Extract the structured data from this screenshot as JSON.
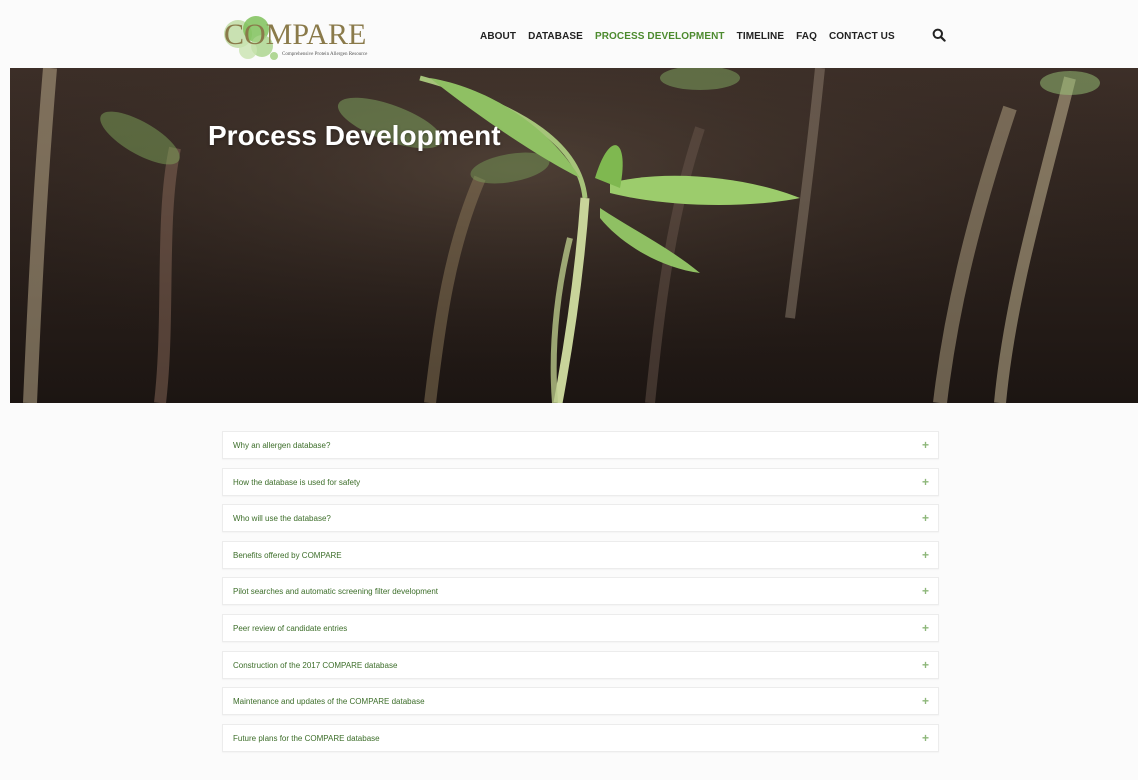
{
  "brand": {
    "name": "COMPARE",
    "tagline": "Comprehensive Protein Allergen Resource"
  },
  "nav": {
    "items": [
      {
        "label": "ABOUT",
        "active": false
      },
      {
        "label": "DATABASE",
        "active": false
      },
      {
        "label": "PROCESS DEVELOPMENT",
        "active": true
      },
      {
        "label": "TIMELINE",
        "active": false
      },
      {
        "label": "FAQ",
        "active": false
      },
      {
        "label": "CONTACT US",
        "active": false
      }
    ],
    "search_icon": "search-icon"
  },
  "hero": {
    "title": "Process Development"
  },
  "accordion": {
    "expand_icon": "plus-icon",
    "expand_glyph": "+",
    "items": [
      {
        "label": "Why an allergen database?"
      },
      {
        "label": "How the database is used for safety"
      },
      {
        "label": "Who will use the database?"
      },
      {
        "label": "Benefits offered by COMPARE"
      },
      {
        "label": "Pilot searches and automatic screening filter development"
      },
      {
        "label": "Peer review of candidate entries"
      },
      {
        "label": "Construction of the 2017 COMPARE database"
      },
      {
        "label": "Maintenance and updates of the COMPARE database"
      },
      {
        "label": "Future plans for the COMPARE database"
      }
    ]
  },
  "colors": {
    "accent": "#4c8a2e",
    "accordion_text": "#3d6e2a",
    "accordion_plus": "#8db77a",
    "logo_text": "#8a7a4a"
  }
}
